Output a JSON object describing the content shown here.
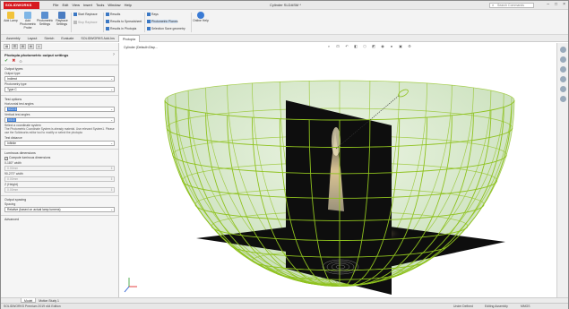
{
  "app": {
    "brand": "SOLIDWORKS",
    "document_title": "Cylinder SLDASM *",
    "search_placeholder": "Search Commands"
  },
  "menu": [
    "File",
    "Edit",
    "View",
    "Insert",
    "Tools",
    "Window",
    "Help"
  ],
  "ribbon": {
    "big_buttons": [
      "Add Lamp",
      "Add Photometric Probe",
      "Photometric Settings",
      "Raytrace Settings"
    ],
    "small_buttons": [
      "Start Raytrace",
      "Stop Raytrace",
      "Results",
      "Results to Spreadsheet",
      "Results in Photopia",
      "Rays",
      "Photometric Planes",
      "Selection Save geometry"
    ],
    "online_label": "Online Help"
  },
  "tabs": [
    "Assembly",
    "Layout",
    "Sketch",
    "Evaluate",
    "SOLIDWORKS Add-Ins",
    "Photopia"
  ],
  "active_tab": "Photopia",
  "panel": {
    "title": "Photopia photometric output settings",
    "output_types_header": "Output types",
    "output_types_label": "Output type",
    "output_type_value": "Indirect",
    "photometry_type_label": "Photometry type",
    "photometry_type_value": "Type C",
    "test_options_header": "Test options",
    "horizontal_label": "Horizontal test angles",
    "horizontal_value": "5/22.5",
    "vertical_label": "Vertical test angles",
    "vertical_value": "0/0.5",
    "coord_label": "Select a coordinate system",
    "coord_note": "The Photometric Coordinate System is already material. Use relevant System1. Please use the Solidworks editor tool to modify or select the photopia",
    "test_distance_label": "Test distance",
    "test_distance_value": "Infinite",
    "dimensions_header": "Luminous dimensions",
    "compute_label": "Compute luminous dimensions",
    "width_label": "0-180° width",
    "width_value": "0.00mm",
    "length_label": "90-270° width",
    "length_value": "0.00mm",
    "height_label": "Z (Height)",
    "height_value": "0.00mm",
    "output_spacing_header": "Output spacing",
    "spacing_label": "Spacing",
    "spacing_value": "Relative (based on actual lamp lumens)",
    "advanced_header": "Advanced"
  },
  "viewport": {
    "breadcrumb": "Cylinder (Default<Disp..."
  },
  "bottom_tabs": [
    "Model",
    "Motion Study 1"
  ],
  "status": {
    "left": "SOLIDWORKS Premium 2019 x64 Edition",
    "m1": "Under Defined",
    "m2": "Editing Assembly",
    "m3": "MMGS"
  },
  "colors": {
    "accent": "#d6191f",
    "wireframe": "#8fc21e",
    "dome_fill": "#cfe4c4",
    "plane": "#0e0e0e"
  }
}
